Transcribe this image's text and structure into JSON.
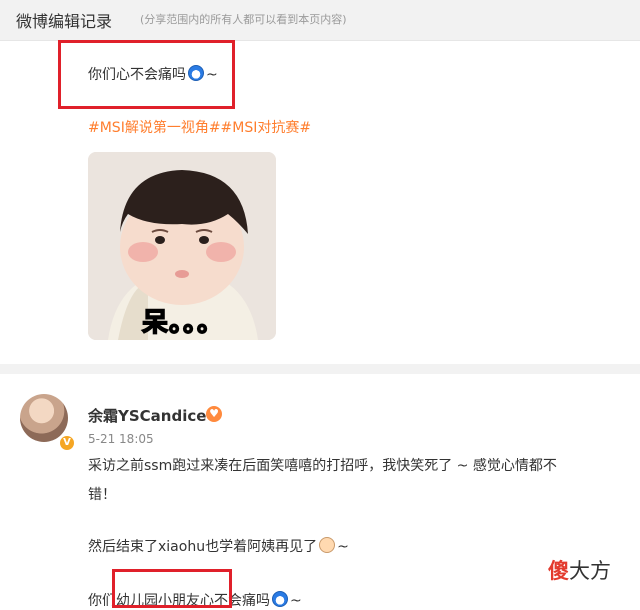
{
  "header": {
    "title": "微博编辑记录",
    "note": "(分享范围内的所有人都可以看到本页内容)"
  },
  "post1": {
    "line1": "你们心不会痛吗",
    "line1_suffix": "~",
    "topics": "#MSI解说第一视角##MSI对抗赛#",
    "image_caption": "呆。。。"
  },
  "post2": {
    "username": "余霜YSCandice",
    "timestamp": "5-21 18:05",
    "verify_mark": "V",
    "user_badge_symbol": "♥",
    "text_line1": "采访之前ssm跑过来凑在后面笑嘻嘻的打招呼，我快笑死了 ~ 感觉心情都不",
    "text_line2": "错！",
    "text_line3": "然后结束了xiaohu也学着阿姨再见了",
    "text_line3_suffix": "~",
    "text_line4": "你们幼儿园小朋友心不会痛吗",
    "text_line4_suffix": "~"
  },
  "watermark": {
    "char1": "傻",
    "rest": "大方"
  },
  "colors": {
    "topic": "#ff7e2e",
    "highlight_box": "#e0202a",
    "header_bg": "#f2f2f2"
  }
}
